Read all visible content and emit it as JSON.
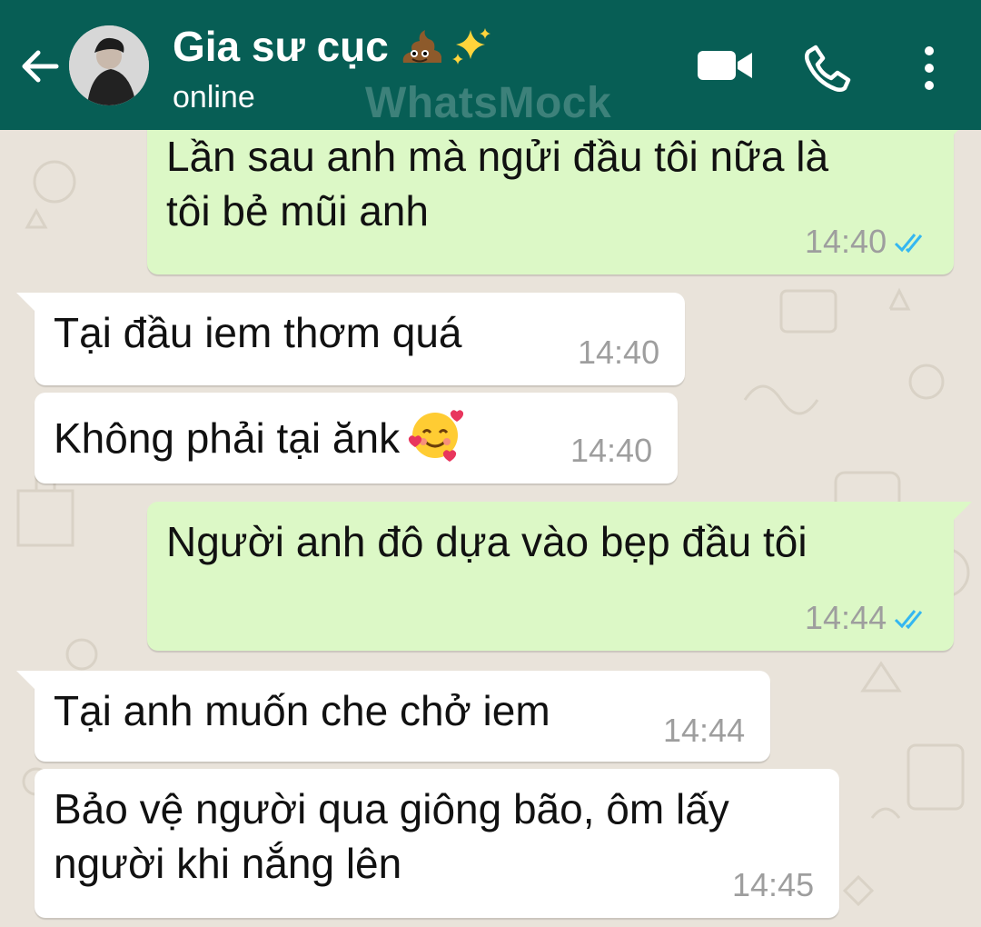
{
  "header": {
    "title": "Gia sư cục",
    "title_emoji": "poo-and-sparkles-emoji",
    "status": "online",
    "watermark": "WhatsMock",
    "background_color": "#075e55"
  },
  "icons": {
    "back": "arrow-left-icon",
    "video": "video-camera-icon",
    "call": "phone-icon",
    "menu": "vertical-dots-icon",
    "read_ticks": "double-check-icon",
    "emoji_in_message": "smiling-face-with-hearts-emoji"
  },
  "colors": {
    "outgoing_bubble": "#dcf8c6",
    "incoming_bubble": "#ffffff",
    "read_ticks": "#34b7f1",
    "time_text": "#9e9e9e"
  },
  "messages": [
    {
      "direction": "out",
      "lines": [
        "Lần sau anh mà ngửi đầu tôi nữa là",
        "tôi bẻ mũi anh"
      ],
      "time": "14:40",
      "read": true
    },
    {
      "direction": "in",
      "lines": [
        "Tại đầu iem thơm quá"
      ],
      "time": "14:40"
    },
    {
      "direction": "in",
      "lines": [
        "Không phải tại ănk"
      ],
      "time": "14:40",
      "emoji": "smiling-face-with-hearts-emoji"
    },
    {
      "direction": "out",
      "lines": [
        "Người anh đô dựa vào bẹp đầu tôi"
      ],
      "time": "14:44",
      "read": true
    },
    {
      "direction": "in",
      "lines": [
        "Tại anh muốn che chở iem"
      ],
      "time": "14:44"
    },
    {
      "direction": "in",
      "lines": [
        "Bảo vệ người qua giông bão, ôm lấy",
        "người khi nắng lên"
      ],
      "time": "14:45"
    }
  ]
}
